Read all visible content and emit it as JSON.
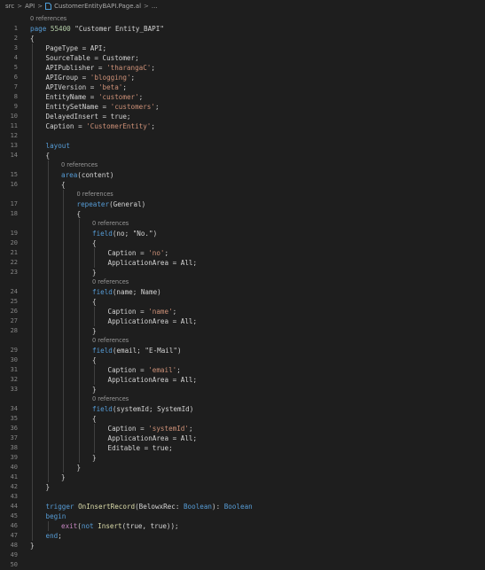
{
  "breadcrumb": {
    "items": [
      "src",
      "API",
      "CustomerEntityBAPI.Page.al",
      "..."
    ],
    "separator": ">"
  },
  "codelens_label": "0 references",
  "lines": [
    {
      "n": 1,
      "indent": 0,
      "tokens": [
        [
          "kw",
          "page"
        ],
        [
          "t",
          " "
        ],
        [
          "num",
          "55400"
        ],
        [
          "t",
          " \"Customer Entity_BAPI\""
        ]
      ],
      "lens": true
    },
    {
      "n": 2,
      "indent": 0,
      "tokens": [
        [
          "t",
          "{"
        ]
      ]
    },
    {
      "n": 3,
      "indent": 1,
      "tokens": [
        [
          "t",
          "PageType = API;"
        ]
      ]
    },
    {
      "n": 4,
      "indent": 1,
      "tokens": [
        [
          "t",
          "SourceTable = Customer;"
        ]
      ]
    },
    {
      "n": 5,
      "indent": 1,
      "tokens": [
        [
          "t",
          "APIPublisher = "
        ],
        [
          "str",
          "'tharangaC'"
        ],
        [
          "t",
          ";"
        ]
      ]
    },
    {
      "n": 6,
      "indent": 1,
      "tokens": [
        [
          "t",
          "APIGroup = "
        ],
        [
          "str",
          "'blogging'"
        ],
        [
          "t",
          ";"
        ]
      ]
    },
    {
      "n": 7,
      "indent": 1,
      "tokens": [
        [
          "t",
          "APIVersion = "
        ],
        [
          "str",
          "'beta'"
        ],
        [
          "t",
          ";"
        ]
      ]
    },
    {
      "n": 8,
      "indent": 1,
      "tokens": [
        [
          "t",
          "EntityName = "
        ],
        [
          "str",
          "'customer'"
        ],
        [
          "t",
          ";"
        ]
      ]
    },
    {
      "n": 9,
      "indent": 1,
      "tokens": [
        [
          "t",
          "EntitySetName = "
        ],
        [
          "str",
          "'customers'"
        ],
        [
          "t",
          ";"
        ]
      ]
    },
    {
      "n": 10,
      "indent": 1,
      "tokens": [
        [
          "t",
          "DelayedInsert = true;"
        ]
      ]
    },
    {
      "n": 11,
      "indent": 1,
      "tokens": [
        [
          "t",
          "Caption = "
        ],
        [
          "str",
          "'CustomerEntity'"
        ],
        [
          "t",
          ";"
        ]
      ]
    },
    {
      "n": 12,
      "indent": 0,
      "tokens": []
    },
    {
      "n": 13,
      "indent": 1,
      "tokens": [
        [
          "kw",
          "layout"
        ]
      ]
    },
    {
      "n": 14,
      "indent": 1,
      "tokens": [
        [
          "t",
          "{"
        ]
      ]
    },
    {
      "n": 15,
      "indent": 2,
      "tokens": [
        [
          "kw",
          "area"
        ],
        [
          "t",
          "(content)"
        ]
      ],
      "lens": true
    },
    {
      "n": 16,
      "indent": 2,
      "tokens": [
        [
          "t",
          "{"
        ]
      ]
    },
    {
      "n": 17,
      "indent": 3,
      "tokens": [
        [
          "kw",
          "repeater"
        ],
        [
          "t",
          "(General)"
        ]
      ],
      "lens": true
    },
    {
      "n": 18,
      "indent": 3,
      "tokens": [
        [
          "t",
          "{"
        ]
      ]
    },
    {
      "n": 19,
      "indent": 4,
      "tokens": [
        [
          "kw",
          "field"
        ],
        [
          "t",
          "(no; \"No.\")"
        ]
      ],
      "lens": true
    },
    {
      "n": 20,
      "indent": 4,
      "tokens": [
        [
          "t",
          "{"
        ]
      ]
    },
    {
      "n": 21,
      "indent": 5,
      "tokens": [
        [
          "t",
          "Caption = "
        ],
        [
          "str",
          "'no'"
        ],
        [
          "t",
          ";"
        ]
      ]
    },
    {
      "n": 22,
      "indent": 5,
      "tokens": [
        [
          "t",
          "ApplicationArea = All;"
        ]
      ]
    },
    {
      "n": 23,
      "indent": 4,
      "tokens": [
        [
          "t",
          "}"
        ]
      ]
    },
    {
      "n": 24,
      "indent": 4,
      "tokens": [
        [
          "kw",
          "field"
        ],
        [
          "t",
          "(name; Name)"
        ]
      ],
      "lens": true
    },
    {
      "n": 25,
      "indent": 4,
      "tokens": [
        [
          "t",
          "{"
        ]
      ]
    },
    {
      "n": 26,
      "indent": 5,
      "tokens": [
        [
          "t",
          "Caption = "
        ],
        [
          "str",
          "'name'"
        ],
        [
          "t",
          ";"
        ]
      ]
    },
    {
      "n": 27,
      "indent": 5,
      "tokens": [
        [
          "t",
          "ApplicationArea = All;"
        ]
      ]
    },
    {
      "n": 28,
      "indent": 4,
      "tokens": [
        [
          "t",
          "}"
        ]
      ]
    },
    {
      "n": 29,
      "indent": 4,
      "tokens": [
        [
          "kw",
          "field"
        ],
        [
          "t",
          "(email; \"E-Mail\")"
        ]
      ],
      "lens": true
    },
    {
      "n": 30,
      "indent": 4,
      "tokens": [
        [
          "t",
          "{"
        ]
      ]
    },
    {
      "n": 31,
      "indent": 5,
      "tokens": [
        [
          "t",
          "Caption = "
        ],
        [
          "str",
          "'email'"
        ],
        [
          "t",
          ";"
        ]
      ]
    },
    {
      "n": 32,
      "indent": 5,
      "tokens": [
        [
          "t",
          "ApplicationArea = All;"
        ]
      ]
    },
    {
      "n": 33,
      "indent": 4,
      "tokens": [
        [
          "t",
          "}"
        ]
      ]
    },
    {
      "n": 34,
      "indent": 4,
      "tokens": [
        [
          "kw",
          "field"
        ],
        [
          "t",
          "(systemId; SystemId)"
        ]
      ],
      "lens": true
    },
    {
      "n": 35,
      "indent": 4,
      "tokens": [
        [
          "t",
          "{"
        ]
      ]
    },
    {
      "n": 36,
      "indent": 5,
      "tokens": [
        [
          "t",
          "Caption = "
        ],
        [
          "str",
          "'systemId'"
        ],
        [
          "t",
          ";"
        ]
      ]
    },
    {
      "n": 37,
      "indent": 5,
      "tokens": [
        [
          "t",
          "ApplicationArea = All;"
        ]
      ]
    },
    {
      "n": 38,
      "indent": 5,
      "tokens": [
        [
          "t",
          "Editable = true;"
        ]
      ]
    },
    {
      "n": 39,
      "indent": 4,
      "tokens": [
        [
          "t",
          "}"
        ]
      ]
    },
    {
      "n": 40,
      "indent": 3,
      "tokens": [
        [
          "t",
          "}"
        ]
      ]
    },
    {
      "n": 41,
      "indent": 2,
      "tokens": [
        [
          "t",
          "}"
        ]
      ]
    },
    {
      "n": 42,
      "indent": 1,
      "tokens": [
        [
          "t",
          "}"
        ]
      ]
    },
    {
      "n": 43,
      "indent": 0,
      "tokens": []
    },
    {
      "n": 44,
      "indent": 1,
      "tokens": [
        [
          "kw",
          "trigger"
        ],
        [
          "t",
          " "
        ],
        [
          "fn",
          "OnInsertRecord"
        ],
        [
          "t",
          "(BelowxRec: "
        ],
        [
          "kw",
          "Boolean"
        ],
        [
          "t",
          "): "
        ],
        [
          "kw",
          "Boolean"
        ]
      ]
    },
    {
      "n": 45,
      "indent": 1,
      "tokens": [
        [
          "kw",
          "begin"
        ]
      ]
    },
    {
      "n": 46,
      "indent": 2,
      "tokens": [
        [
          "ctl",
          "exit"
        ],
        [
          "t",
          "("
        ],
        [
          "kw",
          "not"
        ],
        [
          "t",
          " "
        ],
        [
          "fn",
          "Insert"
        ],
        [
          "t",
          "(true, true));"
        ]
      ]
    },
    {
      "n": 47,
      "indent": 1,
      "tokens": [
        [
          "kw",
          "end"
        ],
        [
          "t",
          ";"
        ]
      ]
    },
    {
      "n": 48,
      "indent": 0,
      "tokens": [
        [
          "t",
          "}"
        ]
      ]
    },
    {
      "n": 49,
      "indent": 0,
      "tokens": []
    },
    {
      "n": 50,
      "indent": 0,
      "tokens": []
    }
  ],
  "colors": {
    "background": "#1e1e1e",
    "keyword": "#569cd6",
    "control": "#c586c0",
    "number": "#b5cea8",
    "string": "#ce9178",
    "function": "#dcdcaa",
    "text": "#d4d4d4",
    "line_number": "#858585",
    "codelens": "#999999",
    "indent_guide": "#404040",
    "file_icon": "#4f9fd9"
  }
}
